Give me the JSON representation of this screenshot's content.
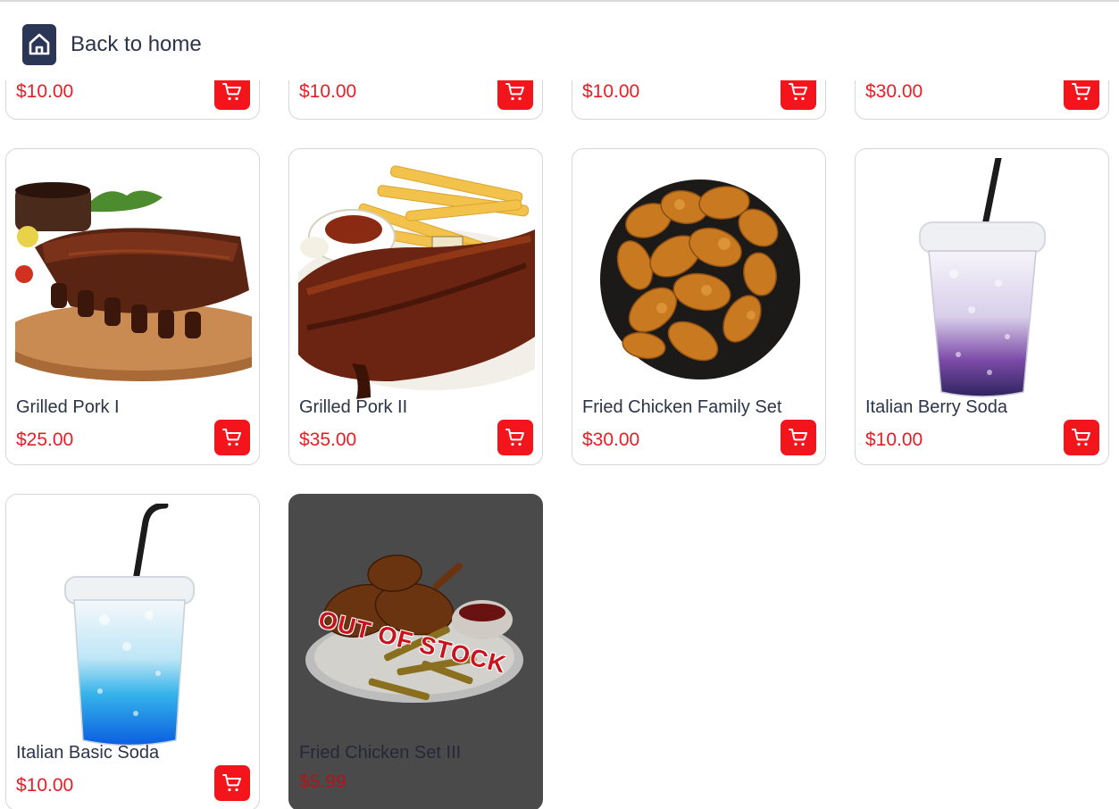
{
  "header": {
    "back_label": "Back to home"
  },
  "colors": {
    "accent": "#f4141b",
    "price": "#e41e26",
    "header_badge": "#2b3656",
    "out_of_stock_bg": "#4a4a4a"
  },
  "top_row": [
    {
      "price": "$10.00"
    },
    {
      "price": "$10.00"
    },
    {
      "price": "$10.00"
    },
    {
      "price": "$30.00"
    }
  ],
  "products": [
    {
      "name": "Grilled Pork I",
      "price": "$25.00",
      "image": "grilled-ribs-board"
    },
    {
      "name": "Grilled Pork II",
      "price": "$35.00",
      "image": "ribs-and-fries"
    },
    {
      "name": "Fried Chicken Family Set",
      "price": "$30.00",
      "image": "fried-chicken-plate"
    },
    {
      "name": "Italian Berry Soda",
      "price": "$10.00",
      "image": "purple-soda-cup"
    },
    {
      "name": "Italian Basic Soda",
      "price": "$10.00",
      "image": "blue-soda-cup"
    },
    {
      "name": "Fried Chicken Set III",
      "price": "$5.99",
      "image": "fried-chicken-fries",
      "overlay_label": "OUT OF STOCK"
    }
  ]
}
